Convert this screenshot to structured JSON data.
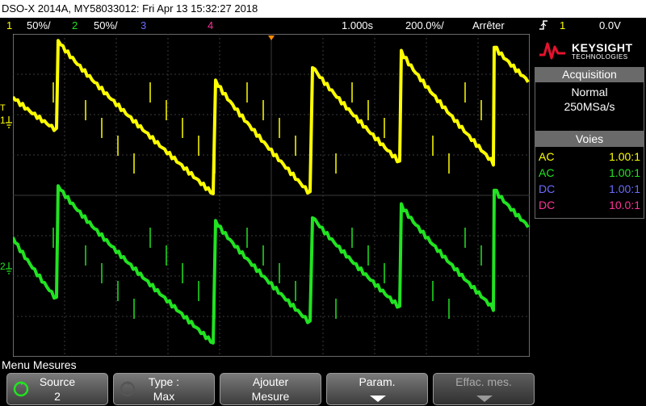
{
  "title": "DSO-X 2014A, MY58033012: Fri Apr 13 15:32:27 2018",
  "status": {
    "ch1": {
      "num": "1",
      "scale": "50%/"
    },
    "ch2": {
      "num": "2",
      "scale": "50%/"
    },
    "ch3": {
      "num": "3"
    },
    "ch4": {
      "num": "4"
    },
    "timebase": "1.000s",
    "delay": "200.0%/",
    "run_state": "Arrêter",
    "trigger_channel": "1",
    "trigger_level": "0.0V"
  },
  "markers": {
    "ch1": "1",
    "ch2": "2",
    "trig": "T"
  },
  "logo": {
    "brand": "KEYSIGHT",
    "sub": "TECHNOLOGIES"
  },
  "acquisition": {
    "header": "Acquisition",
    "mode": "Normal",
    "rate": "250MSa/s"
  },
  "voies": {
    "header": "Voies",
    "rows": [
      {
        "coupling": "AC",
        "probe": "1.00:1",
        "color": "#ffff00"
      },
      {
        "coupling": "AC",
        "probe": "1.00:1",
        "color": "#21e321"
      },
      {
        "coupling": "DC",
        "probe": "1.00:1",
        "color": "#6b6bff"
      },
      {
        "coupling": "DC",
        "probe": "10.0:1",
        "color": "#ff3399"
      }
    ]
  },
  "menu": {
    "title": "Menu Mesures",
    "softkeys": [
      {
        "l1": "Source",
        "l2": "2"
      },
      {
        "l1": "Type :",
        "l2": "Max"
      },
      {
        "l1": "Ajouter",
        "l2": "Mesure"
      },
      {
        "l1": "Param.",
        "l2": ""
      },
      {
        "l1": "Effac. mes.",
        "l2": ""
      }
    ]
  },
  "traces": {
    "ch1_color": "#ffff00",
    "ch2_color": "#21e321"
  },
  "icons": [
    "rotary-knob-icon",
    "down-arrow-icon",
    "trigger-marker-icon",
    "ground-marker-icon"
  ]
}
